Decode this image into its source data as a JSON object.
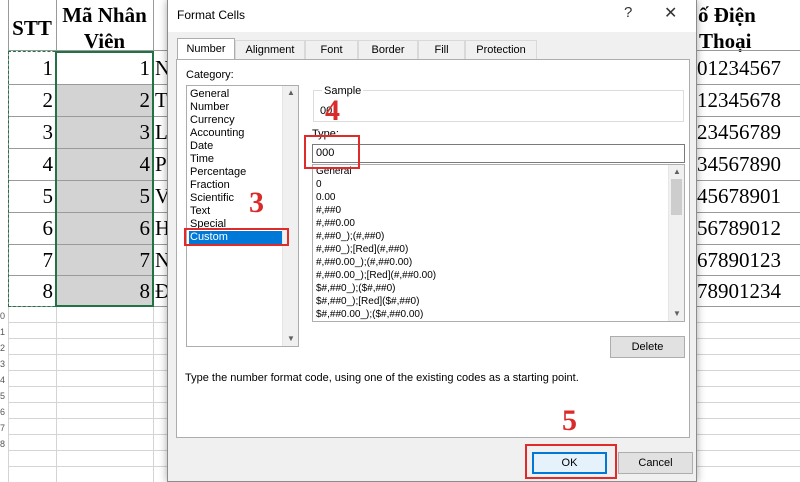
{
  "sheet": {
    "headers": {
      "stt": "STT",
      "ma_nv_1": "Mã Nhân",
      "ma_nv_2": "Viên",
      "sdt_1": "ố Điện",
      "sdt_2": "Thoại"
    },
    "stt": [
      "1",
      "2",
      "3",
      "4",
      "5",
      "6",
      "7",
      "8"
    ],
    "ma_nv": [
      "1",
      "2",
      "3",
      "4",
      "5",
      "6",
      "7",
      "8"
    ],
    "name_initials": [
      "N",
      "T",
      "L",
      "P",
      "V",
      "H",
      "N",
      "Đ"
    ],
    "phones": [
      "01234567",
      "12345678",
      "23456789",
      "34567890",
      "45678901",
      "56789012",
      "67890123",
      "78901234"
    ],
    "row_numbers": [
      "0",
      "1",
      "2",
      "3",
      "4",
      "5",
      "6",
      "7",
      "8"
    ]
  },
  "dialog": {
    "title": "Format Cells",
    "help_glyph": "?",
    "close_glyph": "✕",
    "tabs": [
      "Number",
      "Alignment",
      "Font",
      "Border",
      "Fill",
      "Protection"
    ],
    "active_tab": "Number",
    "category_label": "Category:",
    "categories": [
      "General",
      "Number",
      "Currency",
      "Accounting",
      "Date",
      "Time",
      "Percentage",
      "Fraction",
      "Scientific",
      "Text",
      "Special",
      "Custom"
    ],
    "selected_category": "Custom",
    "sample_label": "Sample",
    "sample_value": "00",
    "type_label": "Type:",
    "type_value": "000",
    "formats": [
      "General",
      "0",
      "0.00",
      "#,##0",
      "#,##0.00",
      "#,##0_);(#,##0)",
      "#,##0_);[Red](#,##0)",
      "#,##0.00_);(#,##0.00)",
      "#,##0.00_);[Red](#,##0.00)",
      "$#,##0_);($#,##0)",
      "$#,##0_);[Red]($#,##0)",
      "$#,##0.00_);($#,##0.00)"
    ],
    "delete_label": "Delete",
    "hint": "Type the number format code, using one of the existing codes as a starting point.",
    "ok_label": "OK",
    "cancel_label": "Cancel"
  },
  "annotations": {
    "step3": "3",
    "step4": "4",
    "step5": "5",
    "color": "#d92b2b"
  },
  "colors": {
    "selection": "#0078d7",
    "sheet_selection": "#217346",
    "highlight": "#d3d3d3"
  }
}
